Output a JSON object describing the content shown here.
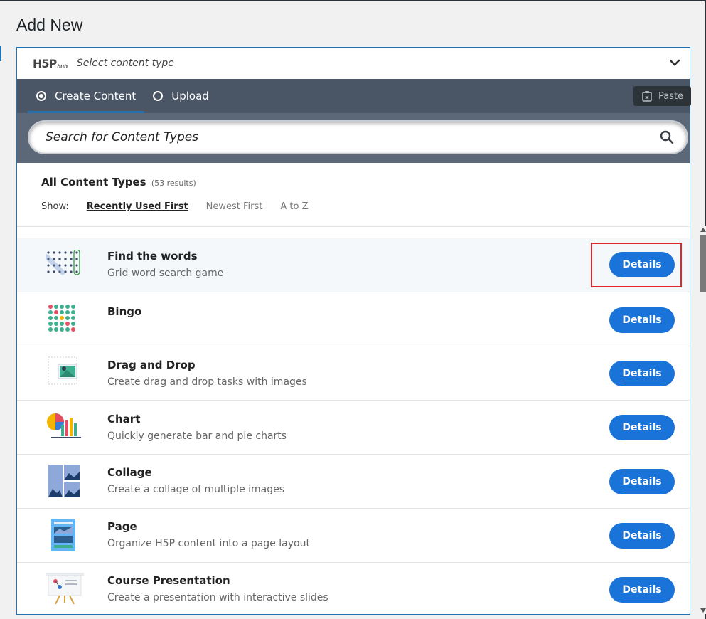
{
  "page": {
    "title": "Add New"
  },
  "hub": {
    "logo_text": "H5P",
    "logo_sub": "hub",
    "select_label": "Select content type"
  },
  "tabs": [
    {
      "label": "Create Content",
      "selected": true
    },
    {
      "label": "Upload",
      "selected": false
    }
  ],
  "paste": {
    "label": "Paste"
  },
  "search": {
    "placeholder": "Search for Content Types"
  },
  "results": {
    "title": "All Content Types",
    "count": "(53 results)",
    "show_label": "Show:",
    "sort_options": [
      "Recently Used First",
      "Newest First",
      "A to Z"
    ],
    "active_sort": "Recently Used First"
  },
  "items": [
    {
      "title": "Find the words",
      "desc": "Grid word search game",
      "icon": "find-the-words-icon",
      "button": "Details"
    },
    {
      "title": "Bingo",
      "desc": "",
      "icon": "bingo-icon",
      "button": "Details"
    },
    {
      "title": "Drag and Drop",
      "desc": "Create drag and drop tasks with images",
      "icon": "drag-and-drop-icon",
      "button": "Details"
    },
    {
      "title": "Chart",
      "desc": "Quickly generate bar and pie charts",
      "icon": "chart-icon",
      "button": "Details"
    },
    {
      "title": "Collage",
      "desc": "Create a collage of multiple images",
      "icon": "collage-icon",
      "button": "Details"
    },
    {
      "title": "Page",
      "desc": "Organize H5P content into a page layout",
      "icon": "page-icon",
      "button": "Details"
    },
    {
      "title": "Course Presentation",
      "desc": "Create a presentation with interactive slides",
      "icon": "course-presentation-icon",
      "button": "Details"
    }
  ],
  "colors": {
    "accent": "#1a73d8",
    "tabs_bg": "#4a5565",
    "search_bg": "#5c6778",
    "highlight": "#e0262c"
  }
}
